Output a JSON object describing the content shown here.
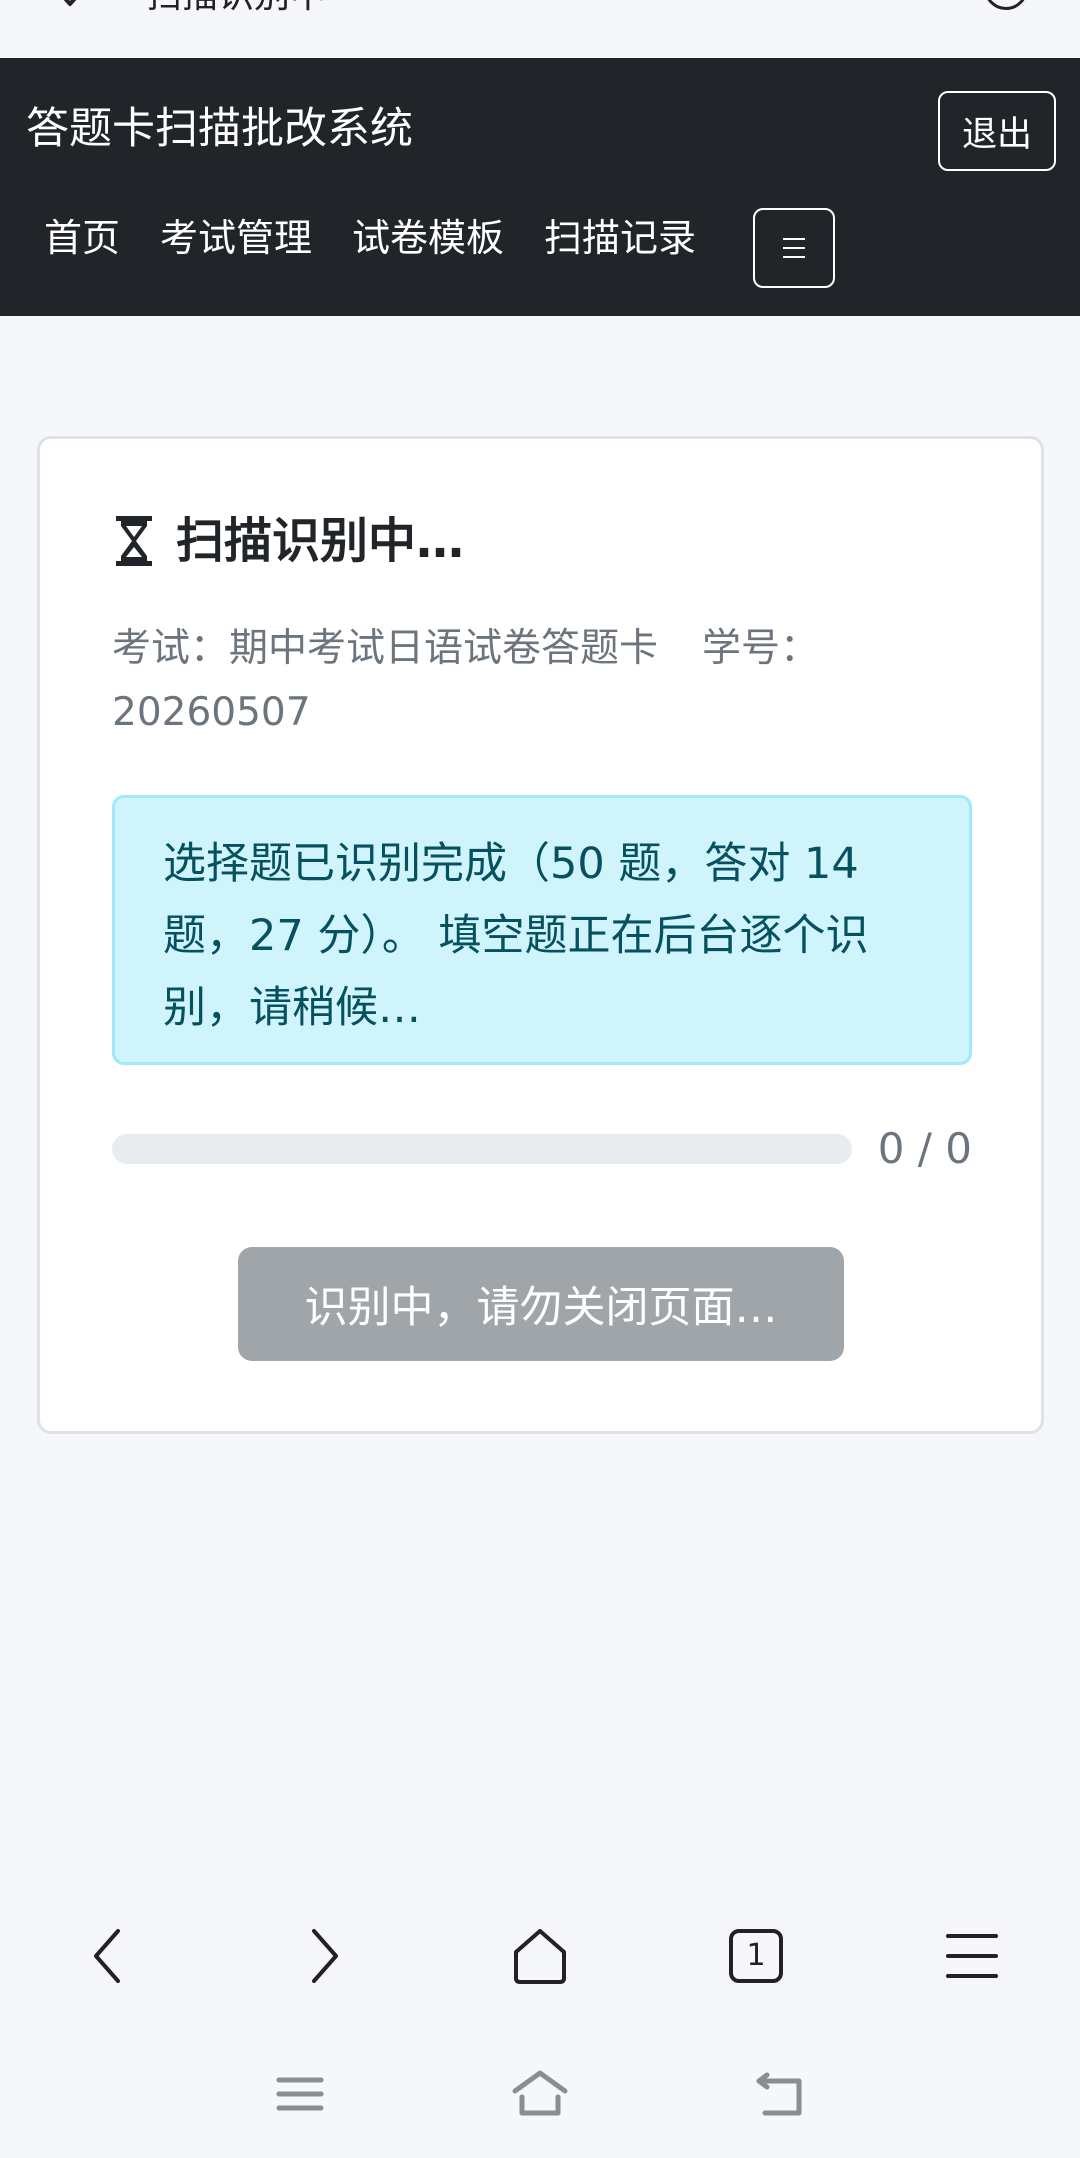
{
  "browser": {
    "tab_title": "扫描识别中",
    "tab_count": "1"
  },
  "navbar": {
    "brand": "答题卡扫描批改系统",
    "logout_label": "退出",
    "links": [
      "首页",
      "考试管理",
      "试卷模板",
      "扫描记录"
    ],
    "menu_icon": "hamburger-icon"
  },
  "card": {
    "title_icon": "hourglass-icon",
    "title": "扫描识别中…",
    "exam_label": "考试：",
    "exam_name": "期中考试日语试卷答题卡",
    "student_label": "学号：",
    "student_id": "20260507",
    "alert_text": "选择题已识别完成（50 题，答对 14 题，27 分）。 填空题正在后台逐个识别，请稍候…",
    "progress_percent": 0,
    "progress_text": "0 / 0",
    "status_button": "识别中，请勿关闭页面…"
  },
  "colors": {
    "navbar_bg": "#212529",
    "alert_bg": "#cff4fc",
    "alert_text": "#055160",
    "status_button_bg": "#a0a5aa"
  }
}
